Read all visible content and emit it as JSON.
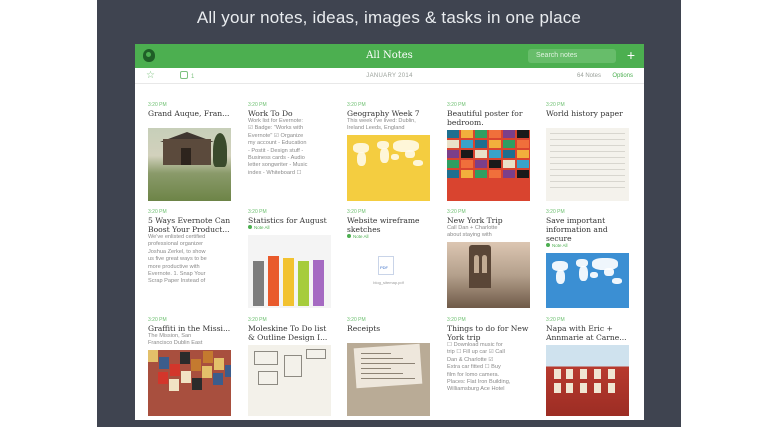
{
  "headline": "All your notes, ideas, images & tasks in one place",
  "topbar": {
    "title": "All Notes",
    "search_placeholder": "Search notes",
    "add_label": "+"
  },
  "subbar": {
    "shortcuts_icon": "star-icon",
    "reminders_count": "1",
    "month": "JANUARY 2014",
    "note_count": "64 Notes",
    "options_label": "Options"
  },
  "colors": {
    "accent": "#4caf50",
    "stage": "#3f4450"
  },
  "notes": [
    {
      "time": "3:20 PM",
      "title": "Grand Auque, Fran...",
      "snippet": "",
      "tag": "",
      "thumb": "barn"
    },
    {
      "time": "3:20 PM",
      "title": "Work To Do",
      "snippet": "Work list for Evernote:\n☑ Badge: \"Works with\nEvernote\" ☑ Organize\nmy account - Education\n- Postit - Design stuff -\nBusiness cards - Audio\nletter songwriter - Music\nindex - Whiteboard ☐",
      "tag": "",
      "thumb": ""
    },
    {
      "time": "3:20 PM",
      "title": "Geography Week 7",
      "snippet": "This week I've lived: Dublin,\nIreland Leeds, England",
      "tag": "",
      "thumb": "map-yellow"
    },
    {
      "time": "3:20 PM",
      "title": "Beautiful poster for\nbedroom.",
      "snippet": "",
      "tag": "",
      "thumb": "poster"
    },
    {
      "time": "3:20 PM",
      "title": "World history paper",
      "snippet": "",
      "tag": "",
      "thumb": "lined"
    },
    {
      "time": "3:20 PM",
      "title": "5 Ways Evernote Can\nBoost Your Product...",
      "snippet": "We've enlisted certified\nprofessional organizer\nJoshua Zerkel, to show\nus five great ways to be\nmore productive with\nEvernote. 1. Snap Your\nScrap Paper Instead of",
      "tag": "",
      "thumb": ""
    },
    {
      "time": "3:20 PM",
      "title": "Statistics for August",
      "snippet": "",
      "tag": "Note All",
      "thumb": "bars"
    },
    {
      "time": "3:20 PM",
      "title": "Website wireframe\nsketches",
      "snippet": "",
      "tag": "Note All",
      "thumb": "pdf"
    },
    {
      "time": "3:20 PM",
      "title": "New York Trip",
      "snippet": "Call Dan + Charlotte\nabout staying with",
      "tag": "",
      "thumb": "bridge"
    },
    {
      "time": "3:20 PM",
      "title": "Save important\ninformation and\nsecure",
      "snippet": "",
      "tag": "Note All",
      "thumb": "map-blue"
    },
    {
      "time": "3:20 PM",
      "title": "Graffiti in the Missi...",
      "snippet": "The Mission, San\nFrancisco Dublin East",
      "tag": "",
      "thumb": "festival"
    },
    {
      "time": "3:20 PM",
      "title": "Moleskine To Do list\n& Outline Design I...",
      "snippet": "",
      "tag": "",
      "thumb": "sketch"
    },
    {
      "time": "3:20 PM",
      "title": "Receipts",
      "snippet": "",
      "tag": "",
      "thumb": "receipt"
    },
    {
      "time": "3:20 PM",
      "title": "Things to do for New\nYork trip",
      "snippet": "☐ Download music for\ntrip ☐ Fill up car ☑ Call\nDan & Charlotte ☑\nExtra car fitted ☐ Buy\nfilm for lomo camera.\nPlaces: Flat Iron Building,\nWilliamsburg Ace Hotel",
      "tag": "",
      "thumb": ""
    },
    {
      "time": "3:20 PM",
      "title": "Napa with Eric +\nAnnmarie at Carne...",
      "snippet": "",
      "tag": "",
      "thumb": "redhouse"
    }
  ],
  "chart_bars": [
    {
      "color": "#7d7d7d",
      "value": 0.78
    },
    {
      "color": "#e95a2c",
      "value": 0.86
    },
    {
      "color": "#f2c230",
      "value": 0.82
    },
    {
      "color": "#a6cc3c",
      "value": 0.78
    },
    {
      "color": "#a56ac2",
      "value": 0.8
    }
  ]
}
